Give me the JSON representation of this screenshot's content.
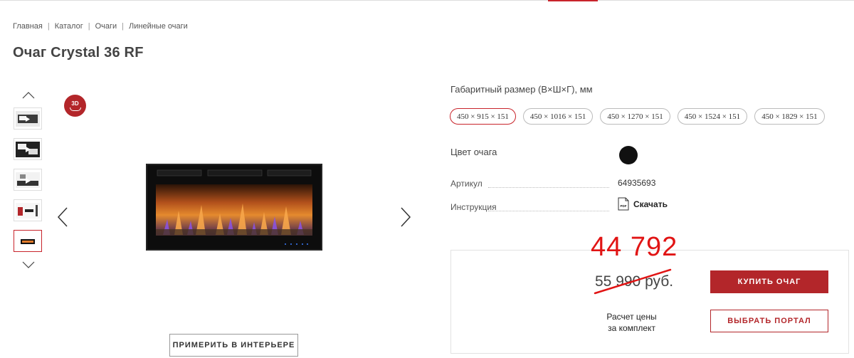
{
  "breadcrumb": [
    "Главная",
    "Каталог",
    "Очаги",
    "Линейные очаги"
  ],
  "product": {
    "title": "Очаг Crystal 36 RF"
  },
  "gallery": {
    "badge_3d": "3D",
    "try_button": "ПРИМЕРИТЬ В ИНТЕРЬЕРЕ",
    "thumbnail_count": 5,
    "active_thumbnail": 5
  },
  "sizes": {
    "label": "Габаритный размер (В×Ш×Г), мм",
    "options": [
      "450 × 915 × 151",
      "450 × 1016 × 151",
      "450 × 1270 × 151",
      "450 × 1524 × 151",
      "450 × 1829 × 151"
    ],
    "selected": "450 × 915 × 151"
  },
  "color": {
    "label": "Цвет очага",
    "swatch": "#111111"
  },
  "specs": {
    "article_label": "Артикул",
    "article_value": "64935693",
    "manual_label": "Инструкция",
    "download_label": "Скачать",
    "pdf_text": "PDF"
  },
  "price": {
    "new": "44 792",
    "old": "55 990 руб.",
    "note_line1": "Расчет цены",
    "note_line2": "за комплект",
    "buy_button": "КУПИТЬ ОЧАГ",
    "portal_button": "ВЫБРАТЬ ПОРТАЛ"
  },
  "colors": {
    "accent": "#b3262a",
    "annotation_red": "#e11414"
  }
}
